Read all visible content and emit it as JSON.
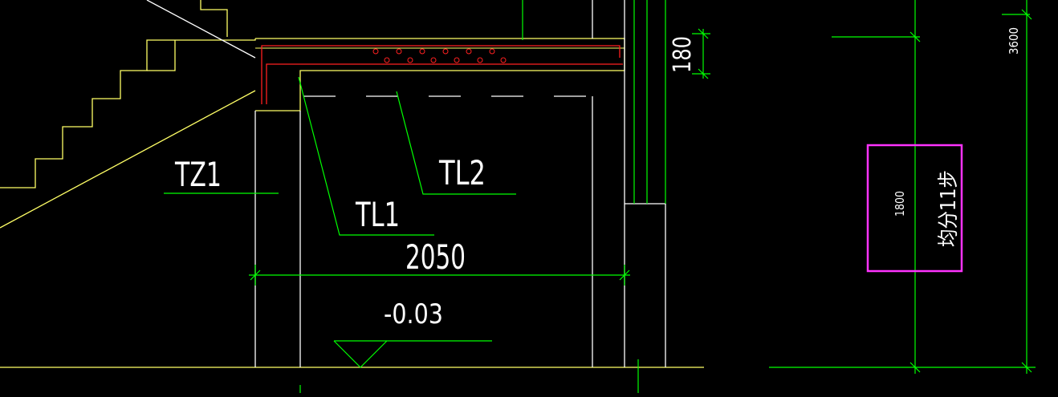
{
  "drawing": {
    "colors": {
      "background": "#000000",
      "concrete_outline": "#ffffff",
      "stair_steps": "#ffff66",
      "dimension_lines": "#00ff00",
      "rebar": "#ff2020",
      "highlight_box": "#ff33ff",
      "text": "#ffffff"
    },
    "labels": {
      "tz1": "TZ1",
      "tl1": "TL1",
      "tl2": "TL2",
      "width_2050": "2050",
      "elevation": "-0.03",
      "thickness_180": "180",
      "height_1800": "1800",
      "height_3600": "3600",
      "steps_note": "均分11步"
    }
  }
}
